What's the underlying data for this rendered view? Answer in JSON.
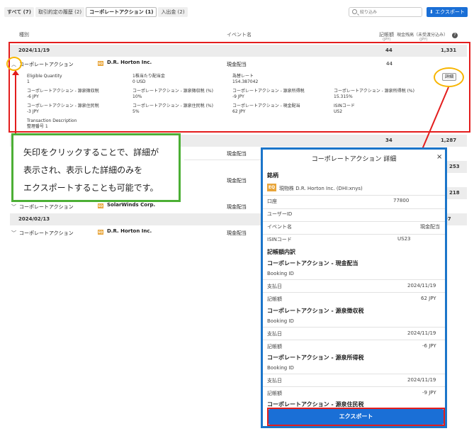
{
  "tabs": [
    {
      "label": "すべて (7)"
    },
    {
      "label": "取引約定の履歴 (2)"
    },
    {
      "label": "コーポレートアクション (1)"
    },
    {
      "label": "入出金 (2)"
    }
  ],
  "search": {
    "placeholder": "絞り込み"
  },
  "toolbar": {
    "export_label": "⬇ エクスポート"
  },
  "table_header": {
    "col_type": "種別",
    "col_event": "イベント名",
    "col_amount": "記帳額",
    "col_amount_unit": "(JPY)",
    "col_cash": "現金残高（未受渡分込み）",
    "col_cash_unit": "(JPY)",
    "help": "?"
  },
  "groups": [
    {
      "date": "2024/11/19",
      "amount": "44",
      "balance": "1,331"
    },
    {
      "amount": "34",
      "balance": "1,287"
    },
    {
      "balance": "253"
    },
    {
      "balance": "218"
    },
    {
      "date": "2024/02/13",
      "balance": "997"
    }
  ],
  "rows": [
    {
      "type": "コーポレートアクション",
      "badge": "EQ",
      "security": "D.R. Horton Inc.",
      "event": "現金配当",
      "amount": "44"
    },
    {
      "event": "現金配当"
    },
    {
      "event": "現金配当"
    },
    {
      "type": "コーポレートアクション",
      "badge": "EQ",
      "security": "SolarWinds Corp.",
      "event": "現金配当"
    },
    {
      "type": "コーポレートアクション",
      "badge": "EQ",
      "security": "D.R. Horton Inc.",
      "event": "現金配当"
    }
  ],
  "details": {
    "eligible_qty_label": "Eligible Quantity",
    "eligible_qty": "1",
    "per_share_label": "1株当たり配当金",
    "per_share": "0 USD",
    "fx_label": "為替レート",
    "fx": "154.387042",
    "detail_button": "詳細",
    "wht_label": "コーポレートアクション - 源泉徴収税",
    "wht": "-6 JPY",
    "wht_pct_label": "コーポレートアクション - 源泉徴収税 (%)",
    "wht_pct": "10%",
    "income_tax_label": "コーポレートアクション - 源泉所得税",
    "income_tax": "-9 JPY",
    "income_tax_pct_label": "コーポレートアクション - 源泉所得税 (%)",
    "income_tax_pct": "15.315%",
    "resident_tax_label": "コーポレートアクション - 源泉住民税",
    "resident_tax": "-3 JPY",
    "resident_tax_pct_label": "コーポレートアクション - 源泉住民税 (%)",
    "resident_tax_pct": "5%",
    "cash_div_label": "コーポレートアクション - 現金配当",
    "cash_div": "62 JPY",
    "isin_label": "ISINコード",
    "isin": "US2",
    "txn_desc_label": "Transaction Description",
    "ref_label": "整理番号 1"
  },
  "callout": {
    "line1": "矢印をクリックすることで、詳細が",
    "line2": "表示され、表示した詳細のみを",
    "line3": "エクスポートすることも可能です。"
  },
  "modal": {
    "title": "コーポレートアクション 詳細",
    "close": "×",
    "section_security": "銘柄",
    "badge": "EQ",
    "security_line": "現物株 D.R. Horton Inc. (DHI:xnys)",
    "account_label": "口座",
    "account_value": "77800",
    "user_id_label": "ユーザーID",
    "event_label": "イベント名",
    "event_value": "現金配当",
    "isin_label": "ISINコード",
    "isin_value": "US23",
    "section_breakdown": "記帳額内訳",
    "items": [
      {
        "title": "コーポレートアクション - 現金配当",
        "booking": "Booking ID",
        "pay_label": "支払日",
        "pay_date": "2024/11/19",
        "amount_label": "記帳額",
        "amount": "62 JPY"
      },
      {
        "title": "コーポレートアクション - 源泉徴収税",
        "booking": "Booking ID",
        "pay_label": "支払日",
        "pay_date": "2024/11/19",
        "amount_label": "記帳額",
        "amount": "-6 JPY"
      },
      {
        "title": "コーポレートアクション - 源泉所得税",
        "booking": "Booking ID",
        "pay_label": "支払日",
        "pay_date": "2024/11/19",
        "amount_label": "記帳額",
        "amount": "-9 JPY"
      }
    ],
    "cut_title": "コーポレートアクション - 源泉住民税",
    "export_label": "エクスポート"
  },
  "colors": {
    "accent": "#1a6fd6",
    "highlight_red": "#e31d1d",
    "callout_green": "#4caf35",
    "circle_yellow": "#f7b500"
  }
}
